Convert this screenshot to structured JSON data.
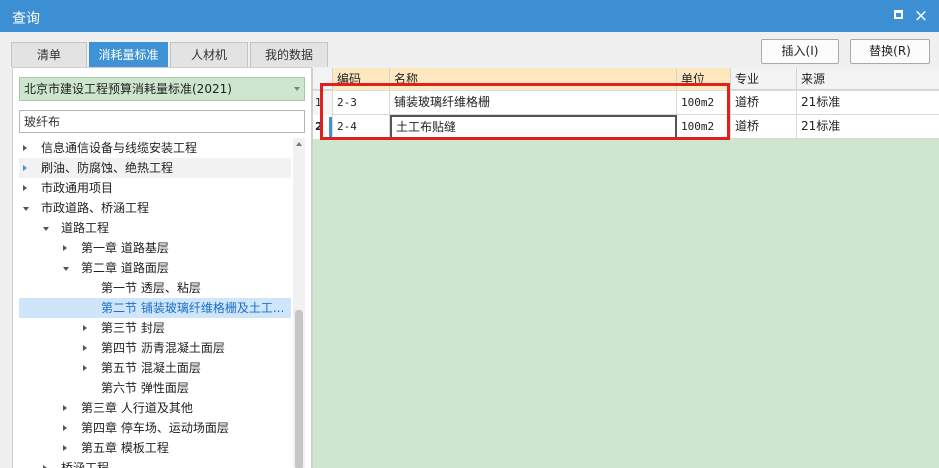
{
  "window": {
    "title": "查询",
    "maximize_label": "",
    "close_label": "×"
  },
  "tabs": [
    {
      "label": "清单"
    },
    {
      "label": "消耗量标准"
    },
    {
      "label": "人材机"
    },
    {
      "label": "我的数据"
    }
  ],
  "actions": {
    "insert_label": "插入(I)",
    "replace_label": "替换(R)"
  },
  "left": {
    "standard_selected": "北京市建设工程预算消耗量标准(2021)",
    "search_value": "玻纤布",
    "tree": [
      {
        "label": "信息通信设备与线缆安装工程",
        "arrow": "collapsed"
      },
      {
        "label": "刷油、防腐蚀、绝热工程",
        "arrow": "collapsed-blue"
      },
      {
        "label": "市政通用项目",
        "arrow": "collapsed"
      },
      {
        "label": "市政道路、桥涵工程",
        "arrow": "expanded"
      },
      {
        "label": "道路工程",
        "arrow": "expanded"
      },
      {
        "label": "第一章 道路基层",
        "arrow": "collapsed"
      },
      {
        "label": "第二章 道路面层",
        "arrow": "expanded"
      },
      {
        "label": "第一节 透层、粘层",
        "arrow": "none"
      },
      {
        "label": "第二节 铺装玻璃纤维格栅及土工...",
        "arrow": "none"
      },
      {
        "label": "第三节 封层",
        "arrow": "collapsed"
      },
      {
        "label": "第四节 沥青混凝土面层",
        "arrow": "collapsed"
      },
      {
        "label": "第五节 混凝土面层",
        "arrow": "collapsed"
      },
      {
        "label": "第六节 弹性面层",
        "arrow": "none"
      },
      {
        "label": "第三章 人行道及其他",
        "arrow": "collapsed"
      },
      {
        "label": "第四章 停车场、运动场面层",
        "arrow": "collapsed"
      },
      {
        "label": "第五章 模板工程",
        "arrow": "collapsed"
      },
      {
        "label": "桥涵工程",
        "arrow": "collapsed"
      }
    ]
  },
  "grid": {
    "columns": [
      "编码",
      "名称",
      "单位",
      "专业",
      "来源"
    ],
    "rows": [
      {
        "num": "1",
        "code": "2-3",
        "name": "铺装玻璃纤维格栅",
        "unit": "100m2",
        "major": "道桥",
        "source": "21标准"
      },
      {
        "num": "2",
        "code": "2-4",
        "name": "土工布贴缝",
        "unit": "100m2",
        "major": "道桥",
        "source": "21标准"
      }
    ]
  },
  "colors": {
    "accent": "#3f92d6",
    "title_bar": "#3c8fd2",
    "grid_background": "#cde6cd",
    "highlight_box": "#e01f1f"
  }
}
